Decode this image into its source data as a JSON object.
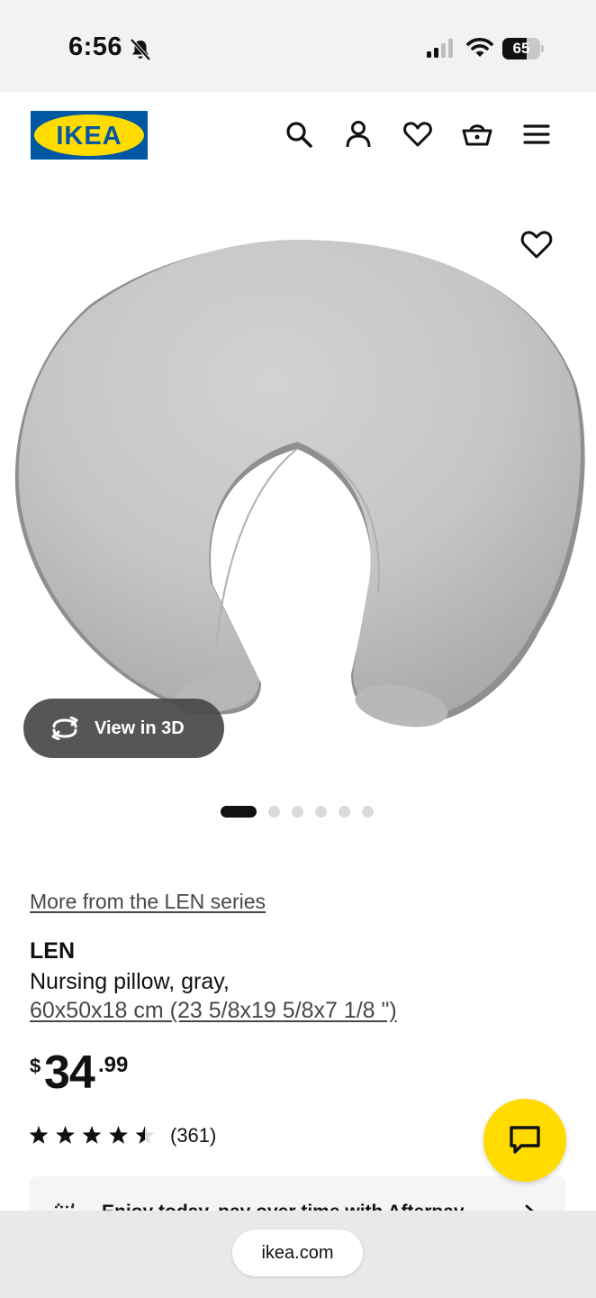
{
  "status_bar": {
    "time": "6:56",
    "battery": "65",
    "battery_level": 0.65
  },
  "header": {
    "logo_text": "IKEA",
    "brand_colors": {
      "blue": "#0058a3",
      "yellow": "#ffdb00"
    },
    "icons": [
      "search-icon",
      "account-icon",
      "heart-icon",
      "basket-icon",
      "menu-icon"
    ]
  },
  "gallery": {
    "view_3d_label": "View in 3D",
    "image_count": 6,
    "active_index": 0
  },
  "product": {
    "series_link": "More from the LEN series",
    "name": "LEN",
    "description": "Nursing pillow, gray,",
    "size": "60x50x18 cm (23 5/8x19 5/8x7 1/8 \")",
    "price": {
      "currency": "$",
      "integer": "34",
      "decimal": ".99"
    },
    "rating": 4.5,
    "review_count": "(361)"
  },
  "afterpay": {
    "text": "Enjoy today, pay over time with Afterpay"
  },
  "browser": {
    "url": "ikea.com"
  }
}
